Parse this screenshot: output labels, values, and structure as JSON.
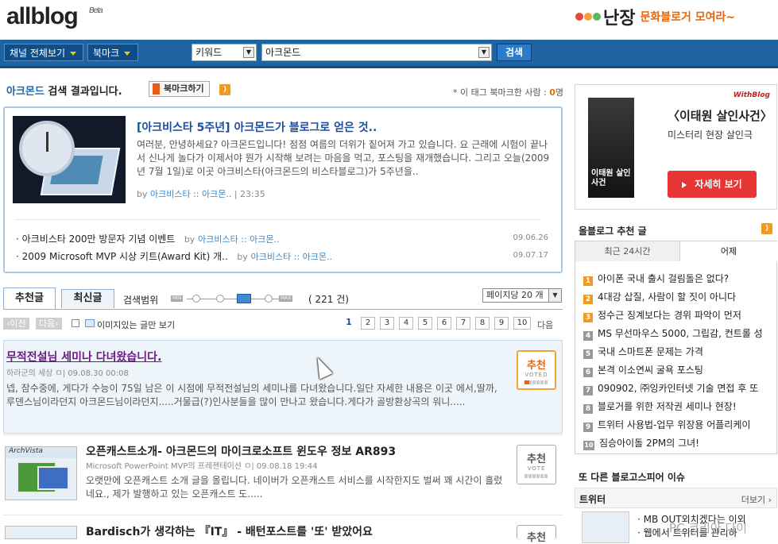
{
  "header": {
    "logo": "allblog",
    "logo_badge": "Beta",
    "banner_brand": "난장",
    "banner_text": "문화블로거 모여라~",
    "colors": {
      "logo_accent": "#d62020",
      "banner_accent": "#e8650a"
    }
  },
  "navbar": {
    "channel_label": "채널 전체보기",
    "bookmark_label": "북마크",
    "search_type": "키워드",
    "search_value": "아크몬드",
    "search_button": "검색",
    "color": "#1f63a3"
  },
  "result": {
    "keyword": "아크몬드",
    "suffix": " 검색 결과입니다.",
    "bookmark_btn": "북마크하기",
    "bookmark_count_label": "* 이 태그 북마크한 사람 : ",
    "bookmark_count": "0",
    "bookmark_count_unit": "명"
  },
  "feature": {
    "title": "[아크비스타 5주년] 아크몬드가 블로그로 얻은 것..",
    "body": "여러분, 안녕하세요? 아크몬드입니다! 점점 여름의 더위가 짙어져 가고 있습니다. 요 근래에 시험이 끝나서 신나게 놀다가 이제서야 뭔가 시작해 보려는 마음을 먹고, 포스팅을 재개했습니다. 그리고 오늘(2009년 7월 1일)로 이곳 아크비스타(아크몬드의 비스타블로그)가 5주년을..",
    "by": "by",
    "author": "아크비스타 :: 아크몬..",
    "time": "| 23:35",
    "list": [
      {
        "title": "· 아크비스타 200만 방문자 기념 이벤트",
        "by": "by",
        "author": "아크비스타 :: 아크몬..",
        "date": "09.06.26"
      },
      {
        "title": "· 2009 Microsoft MVP 시상 키트(Award Kit) 개..",
        "by": "by",
        "author": "아크비스타 :: 아크몬..",
        "date": "09.07.17"
      }
    ]
  },
  "tabs": {
    "recommended": "추천글",
    "latest": "최신글",
    "scope_label": "검색범위",
    "slider_min": "MIN",
    "slider_max": "MAX",
    "count": "( 221 건)",
    "per_page": "페이지당 20 개"
  },
  "pager": {
    "prev": "이전",
    "next_btn": "다음",
    "image_only": "이미지있는 글만 보기",
    "pages": [
      "1",
      "2",
      "3",
      "4",
      "5",
      "6",
      "7",
      "8",
      "9",
      "10"
    ],
    "next_text": "다음"
  },
  "posts": [
    {
      "title": "무적전설님 세미나 다녀왔습니다.",
      "meta": "하라군의 세상 ㅁ| 09.08.30 00:08",
      "body": "넵, 잠수중에, 게다가 수능이 75일 남은 이 시점에 무적전설님의 세미나를 다녀왔습니다.일단 자세한 내용은 이곳 에서,딸까, 루덴스님이라던지 아크몬드님이라던지.....거물급(?)인사분들을 많이 만나고 왔습니다.게다가 골방환상곡의 워니.....",
      "vote": "추천",
      "vote_sub": "VOTED"
    },
    {
      "title": "오픈캐스트소개- 아크몬드의 마이크로소프트 윈도우 정보 AR893",
      "meta": "Microsoft PowerPoint MVP의 프레젠테이션 ㅁ| 09.08.18 19:44",
      "body": "오랫만에 오픈캐스트 소개 글을 올립니다. 네이버가 오픈캐스트 서비스를 시작한지도 벌써 꽤 시간이 흘렀네요., 제가 발행하고 있는 오픈캐스트 도.....",
      "thumb_label": "ArchVista",
      "vote": "추천",
      "vote_sub": "VOTE"
    },
    {
      "title": "Bardisch가 생각하는 『IT』 - 배턴포스트를 '또' 받았어요",
      "vote": "추천"
    }
  ],
  "right": {
    "ad": {
      "brand": "WithBlog",
      "poster_text": "이태원 살인사건",
      "title": "〈이태원 살인사건〉",
      "subtitle": "미스터리 현장 살인극",
      "button": "자세히 보기"
    },
    "recommend_title": "올블로그 추천 글",
    "tab_24h": "최근 24시간",
    "tab_yesterday": "어제",
    "items": [
      {
        "n": "1",
        "t": "아이폰 국내 출시 걸림돌은 없다?"
      },
      {
        "n": "2",
        "t": "4대강 삽질, 사람이 할 짓이 아니다"
      },
      {
        "n": "3",
        "t": "정수근 징계보다는 경위 파악이 먼저"
      },
      {
        "n": "4",
        "t": "MS 무선마우스 5000, 그립감, 컨트롤 성"
      },
      {
        "n": "5",
        "t": "국내 스마트폰 문제는 가격"
      },
      {
        "n": "6",
        "t": "본격 이소연씨 굴욕 포스팅"
      },
      {
        "n": "7",
        "t": "090902, ㈜잉카인터넷 기술 면접 후 또"
      },
      {
        "n": "8",
        "t": "블로거를 위한 저작권 세미나 현장!"
      },
      {
        "n": "9",
        "t": "트위터 사용법-업무 위장용 어플리케이"
      },
      {
        "n": "10",
        "t": "짐승아이돌 2PM의 그녀!"
      }
    ],
    "other_title": "또 다른 블로고스피어 이슈",
    "twitter": "트위터",
    "more": "더보기 ›",
    "tw_items": [
      "· MB OUT외치겠다는 이외",
      "· 웹에서 트위터를 관리하"
    ],
    "watermark": "PC 코리아 다이"
  }
}
